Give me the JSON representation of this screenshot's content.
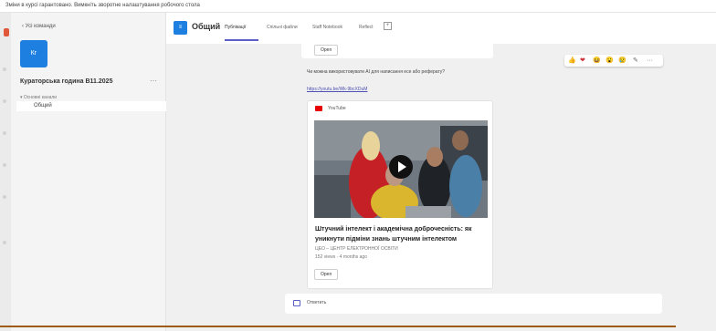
{
  "topbar": {
    "notice": "Зміни в курсі гарантовано. Вимкніть зворотне налаштування робочого стола"
  },
  "sidebar": {
    "back_label": "‹  Усі команди",
    "team_initials": "Кг",
    "team_name": "Кураторська година В11.2025",
    "more": "···",
    "channels_header": "▾ Основні канали",
    "channel_general": "Общий"
  },
  "header": {
    "channel_icon": "≡",
    "title": "Общий",
    "tabs": [
      {
        "label": "Публікації",
        "active": true
      },
      {
        "label": "Спільні файли",
        "active": false
      },
      {
        "label": "Staff Notebook",
        "active": false
      },
      {
        "label": "Reflect",
        "active": false
      }
    ],
    "add_tab": "+"
  },
  "feed": {
    "open_label": "Open",
    "message_text": "Чи можна використовувати AI для написання есе або реферату?",
    "message_link": "https://youtu.be/Wk-9bcXDuM",
    "reactions": [
      "👍",
      "❤",
      "😆",
      "😮",
      "😢",
      "✎",
      "···"
    ],
    "video": {
      "source": "YouTube",
      "title": "Штучний інтелект і академічна доброчесність: як уникнути підміни знань штучним інтелектом",
      "channel": "ЦЕО – ЦЕНТР ЕЛЕКТРОННОЇ ОСВІТИ",
      "stats": "152 views · 4 months ago",
      "open_label": "Open"
    },
    "reply_label": "Ответить"
  },
  "colors": {
    "accent": "#5b5fc7",
    "team_blue": "#1d7fe0",
    "youtube_red": "#e60000"
  }
}
